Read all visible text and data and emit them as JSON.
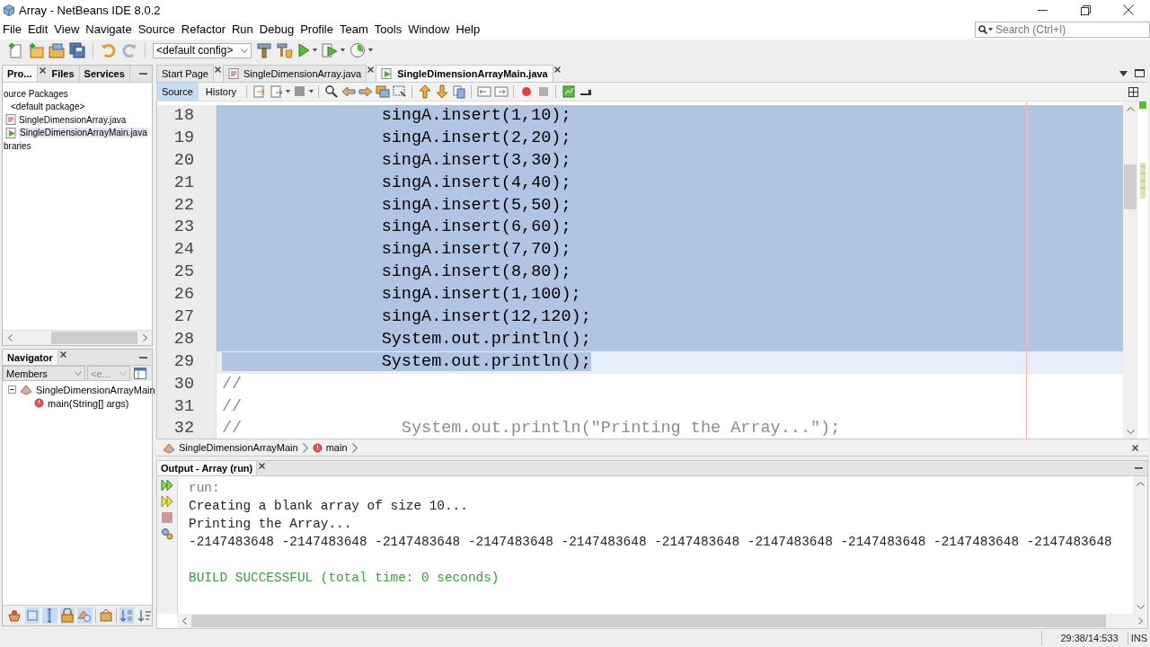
{
  "window": {
    "title": "Array - NetBeans IDE 8.0.2"
  },
  "menu": [
    "File",
    "Edit",
    "View",
    "Navigate",
    "Source",
    "Refactor",
    "Run",
    "Debug",
    "Profile",
    "Team",
    "Tools",
    "Window",
    "Help"
  ],
  "search": {
    "placeholder": "Search (Ctrl+I)"
  },
  "toolbar": {
    "config": "<default config>"
  },
  "projects_panel": {
    "tabs": [
      {
        "label": "Pro...",
        "selected": true,
        "closable": true
      },
      {
        "label": "Files",
        "selected": false,
        "closable": false
      },
      {
        "label": "Services",
        "selected": false,
        "closable": false
      }
    ],
    "tree": [
      {
        "label": "ource Packages",
        "selected": false,
        "children": [
          {
            "label": "<default package>",
            "selected": false,
            "children": [
              {
                "label": "SingleDimensionArray.java",
                "kind": "file",
                "selected": false
              },
              {
                "label": "SingleDimensionArrayMain.java",
                "kind": "main-file",
                "selected": true
              }
            ]
          }
        ]
      },
      {
        "label": "braries",
        "selected": false
      }
    ]
  },
  "navigator": {
    "tab": "Navigator",
    "filter": "Members",
    "filter_2": "<e...",
    "tree": [
      {
        "label": "SingleDimensionArrayMain",
        "kind": "class",
        "expanded": true,
        "children": [
          {
            "label": "main(String[] args)",
            "kind": "method"
          }
        ]
      }
    ],
    "filter_buttons": [
      {
        "pressed": false
      },
      {
        "pressed": true
      },
      {
        "pressed": true
      },
      {
        "pressed": true
      },
      {
        "pressed": true
      },
      {
        "pressed": false
      },
      {
        "pressed": true
      },
      {
        "pressed": false
      }
    ]
  },
  "editor": {
    "tabs": [
      {
        "label": "Start Page",
        "selected": false,
        "kind": "page"
      },
      {
        "label": "SingleDimensionArray.java",
        "selected": false,
        "kind": "java"
      },
      {
        "label": "SingleDimensionArrayMain.java",
        "selected": true,
        "kind": "java-main"
      }
    ],
    "views": [
      {
        "label": "Source",
        "selected": true
      },
      {
        "label": "History",
        "selected": false
      }
    ],
    "lines": [
      {
        "number": "18",
        "text": "                singA.insert(1,10);",
        "kind": "code",
        "selected": true,
        "current": false
      },
      {
        "number": "19",
        "text": "                singA.insert(2,20);",
        "kind": "code",
        "selected": true,
        "current": false
      },
      {
        "number": "20",
        "text": "                singA.insert(3,30);",
        "kind": "code",
        "selected": true,
        "current": false
      },
      {
        "number": "21",
        "text": "                singA.insert(4,40);",
        "kind": "code",
        "selected": true,
        "current": false
      },
      {
        "number": "22",
        "text": "                singA.insert(5,50);",
        "kind": "code",
        "selected": true,
        "current": false
      },
      {
        "number": "23",
        "text": "                singA.insert(6,60);",
        "kind": "code",
        "selected": true,
        "current": false
      },
      {
        "number": "24",
        "text": "                singA.insert(7,70);",
        "kind": "code",
        "selected": true,
        "current": false
      },
      {
        "number": "25",
        "text": "                singA.insert(8,80);",
        "kind": "code",
        "selected": true,
        "current": false
      },
      {
        "number": "26",
        "text": "                singA.insert(1,100);",
        "kind": "code",
        "selected": true,
        "current": false
      },
      {
        "number": "27",
        "text": "                singA.insert(12,120);",
        "kind": "code",
        "selected": true,
        "current": false
      },
      {
        "number": "28",
        "text": "                System.out.println();",
        "kind": "code",
        "selected": true,
        "current": false
      },
      {
        "number": "29",
        "text": "                System.out.println();",
        "kind": "code",
        "selected": true,
        "current": true
      },
      {
        "number": "30",
        "text": "//",
        "kind": "comment",
        "selected": false,
        "current": false
      },
      {
        "number": "31",
        "text": "//",
        "kind": "comment",
        "selected": false,
        "current": false
      },
      {
        "number": "32",
        "text": "//                System.out.println(\"Printing the Array...\");",
        "kind": "comment",
        "selected": false,
        "current": false
      }
    ],
    "breadcrumbs": [
      {
        "label": "SingleDimensionArrayMain",
        "kind": "class"
      },
      {
        "label": "main",
        "kind": "method"
      }
    ]
  },
  "output": {
    "tab": "Output - Array (run)",
    "lines": [
      {
        "text": "run:",
        "kind": "info"
      },
      {
        "text": "Creating a blank array of size 10...",
        "kind": "normal"
      },
      {
        "text": "Printing the Array...",
        "kind": "normal"
      },
      {
        "text": "-2147483648 -2147483648 -2147483648 -2147483648 -2147483648 -2147483648 -2147483648 -2147483648 -2147483648 -2147483648",
        "kind": "normal"
      }
    ],
    "result": {
      "text": "BUILD SUCCESSFUL (total time: 0 seconds)",
      "kind": "success"
    }
  },
  "status_bar": {
    "position": "29:38/14:533",
    "mode": "INS"
  }
}
